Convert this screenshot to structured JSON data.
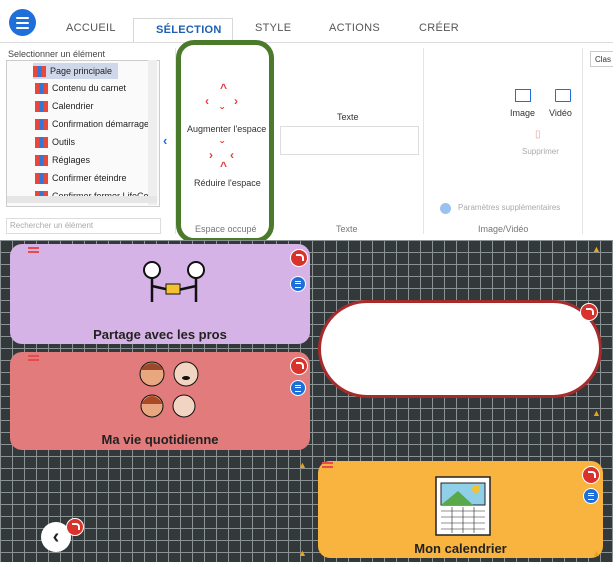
{
  "tabs": [
    "ACCUEIL",
    "SÉLECTION",
    "STYLE",
    "ACTIONS",
    "CRÉER"
  ],
  "element_panel": {
    "label": "Selectionner un élément",
    "items": [
      "Page principale",
      "Contenu du carnet",
      "Calendrier",
      "Confirmation démarrage",
      "Outils",
      "Réglages",
      "Confirmer éteindre",
      "Confirmer fermer LifeCo"
    ],
    "search_placeholder": "Rechercher un élément"
  },
  "space": {
    "increase_label": "Augmenter l'espace",
    "decrease_label": "Réduire l'espace",
    "section_label": "Espace occupé"
  },
  "text": {
    "label": "Texte",
    "section_label": "Texte"
  },
  "media": {
    "image_label": "Image",
    "video_label": "Vidéo",
    "delete_label": "Supprimer",
    "settings_label": "Paramètres supplémentaires",
    "section_label": "Image/Vidéo"
  },
  "class_dropdown": "Clas",
  "cards": {
    "pros": "Partage avec les pros",
    "daily": "Ma vie quotidienne",
    "calendar": "Mon calendrier"
  },
  "colors": {
    "accent": "#1e6fd9",
    "highlight_border": "#4a7a2a",
    "pros_card": "#d6b3e6",
    "daily_card": "#e27b7b",
    "calendar_card": "#f8b43e",
    "warning": "#e8a416"
  }
}
